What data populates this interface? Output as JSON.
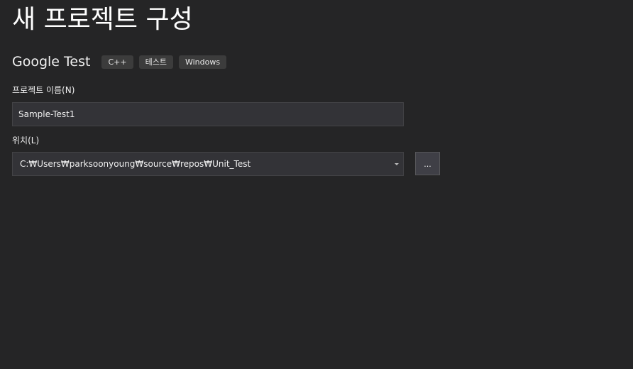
{
  "page": {
    "title": "새 프로젝트 구성"
  },
  "template": {
    "name": "Google Test",
    "tags": [
      "C++",
      "테스트",
      "Windows"
    ]
  },
  "project_name": {
    "label": "프로젝트 이름(N)",
    "value": "Sample-Test1"
  },
  "location": {
    "label": "위치(L)",
    "value": "C:₩Users₩parksoonyoung₩source₩repos₩Unit_Test",
    "browse_label": "..."
  },
  "colors": {
    "background": "#252526",
    "input_background": "#333337",
    "input_border": "#434346",
    "tag_background": "#3c3c3c",
    "text": "#f1f1f1"
  },
  "icons": {
    "dropdown": "chevron-down-icon"
  }
}
